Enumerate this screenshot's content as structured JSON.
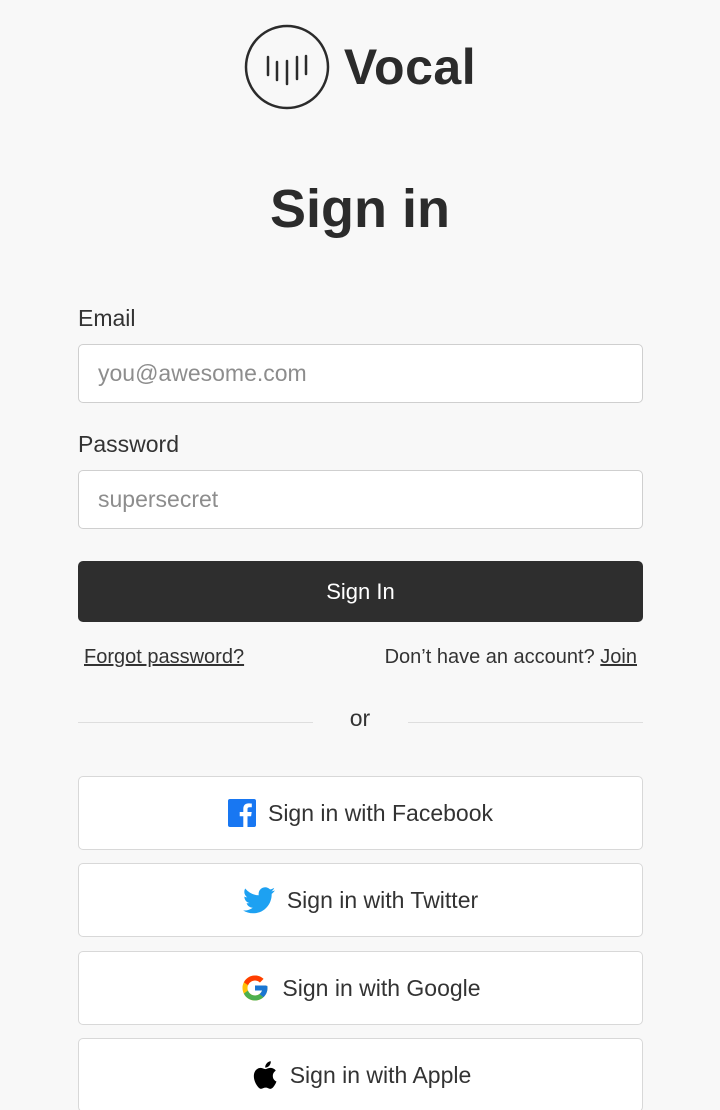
{
  "brand": {
    "name": "Vocal",
    "logo_icon": "waveform-circle-icon"
  },
  "page": {
    "title": "Sign in"
  },
  "form": {
    "email_label": "Email",
    "email_value": "",
    "email_placeholder": "you@awesome.com",
    "password_label": "Password",
    "password_value": "",
    "password_placeholder": "supersecret",
    "submit_label": "Sign In"
  },
  "links": {
    "forgot_password": "Forgot password?",
    "no_account_text": "Don’t have an account?",
    "join": "Join"
  },
  "divider": {
    "text": "or"
  },
  "social": [
    {
      "label": "Sign in with Facebook",
      "icon": "facebook-icon",
      "color": "#1877f2"
    },
    {
      "label": "Sign in with Twitter",
      "icon": "twitter-icon",
      "color": "#1da1f2"
    },
    {
      "label": "Sign in with Google",
      "icon": "google-icon",
      "color": "#4285f4"
    },
    {
      "label": "Sign in with Apple",
      "icon": "apple-icon",
      "color": "#000000"
    }
  ],
  "colors": {
    "background": "#f8f8f8",
    "primary_button": "#2e2e2e",
    "text": "#2b2b2b"
  }
}
